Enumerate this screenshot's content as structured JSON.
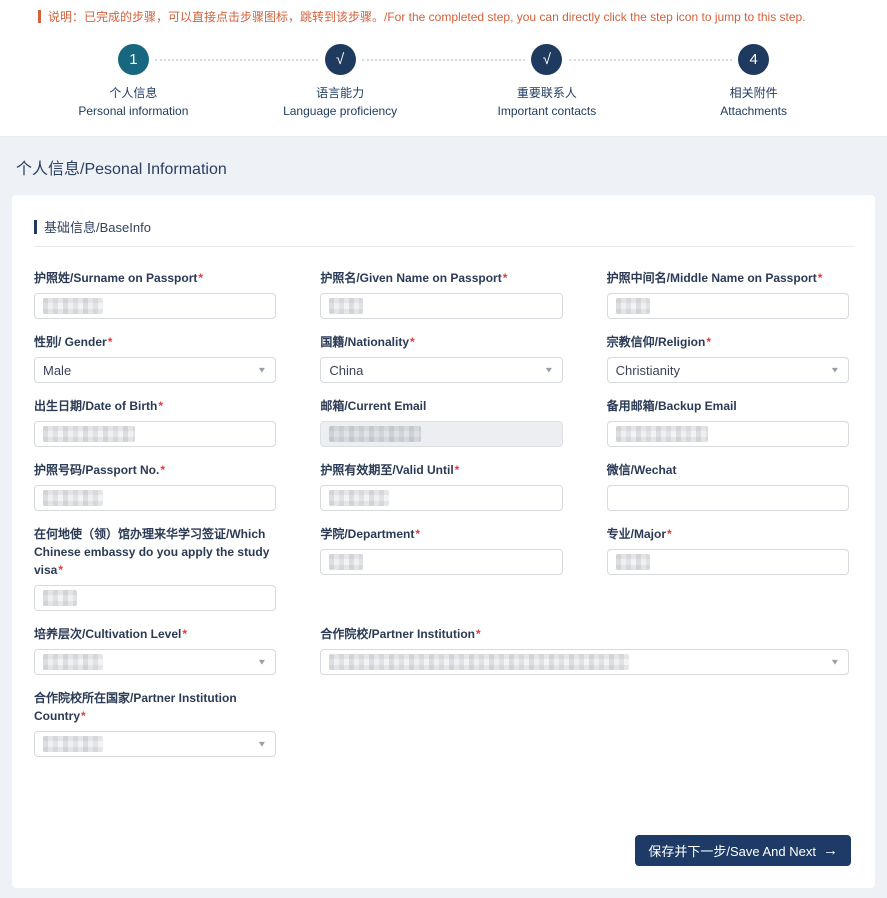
{
  "notice": {
    "text": "说明：已完成的步骤，可以直接点击步骤图标，跳转到该步骤。/For the completed step, you can directly click the step icon to jump to this step."
  },
  "stepper": {
    "steps": [
      {
        "icon": "1",
        "zh": "个人信息",
        "en": "Personal information",
        "state": "active"
      },
      {
        "icon": "√",
        "zh": "语言能力",
        "en": "Language proficiency",
        "state": "done"
      },
      {
        "icon": "√",
        "zh": "重要联系人",
        "en": "Important contacts",
        "state": "done"
      },
      {
        "icon": "4",
        "zh": "相关附件",
        "en": "Attachments",
        "state": "pending"
      }
    ]
  },
  "page": {
    "title": "个人信息/Pesonal Information"
  },
  "card": {
    "section_title": "基础信息/BaseInfo",
    "fields": [
      {
        "label": "护照姓/Surname on Passport",
        "required_mark": "*",
        "type": "text",
        "value_redacted": true
      },
      {
        "label": "护照名/Given Name on Passport",
        "required_mark": "*",
        "type": "text",
        "value_redacted": true
      },
      {
        "label": "护照中间名/Middle Name on Passport",
        "required_mark": "*",
        "type": "text",
        "value_redacted": true
      },
      {
        "label": "性别/ Gender",
        "required_mark": "*",
        "type": "select",
        "value": "Male"
      },
      {
        "label": "国籍/Nationality",
        "required_mark": "*",
        "type": "select",
        "value": "China"
      },
      {
        "label": "宗教信仰/Religion",
        "required_mark": "*",
        "type": "select",
        "value": "Christianity"
      },
      {
        "label": "出生日期/Date of Birth",
        "required_mark": "*",
        "type": "text",
        "value_redacted": true
      },
      {
        "label": "邮箱/Current Email",
        "required_mark": "",
        "type": "text",
        "disabled": true,
        "value_redacted": true
      },
      {
        "label": "备用邮箱/Backup Email",
        "required_mark": "",
        "type": "text",
        "value_redacted": true
      },
      {
        "label": "护照号码/Passport No.",
        "required_mark": "*",
        "type": "text",
        "value_redacted": true
      },
      {
        "label": "护照有效期至/Valid Until",
        "required_mark": "*",
        "type": "text",
        "value_redacted": true
      },
      {
        "label": "微信/Wechat",
        "required_mark": "",
        "type": "text",
        "value": ""
      },
      {
        "label": "在何地使（领）馆办理来华学习签证/Which Chinese embassy do you apply the study visa",
        "required_mark": "*",
        "type": "text",
        "value_redacted": true
      },
      {
        "label": "学院/Department",
        "required_mark": "*",
        "type": "text",
        "value_redacted": true
      },
      {
        "label": "专业/Major",
        "required_mark": "*",
        "type": "text",
        "value_redacted": true
      },
      {
        "label": "培养层次/Cultivation Level",
        "required_mark": "*",
        "type": "select",
        "value_redacted": true
      },
      {
        "label": "合作院校/Partner Institution",
        "required_mark": "*",
        "type": "select",
        "value_redacted": true
      },
      {
        "label": "合作院校所在国家/Partner Institution Country",
        "required_mark": "*",
        "type": "select",
        "value_redacted": true
      }
    ],
    "save_button": {
      "label": "保存并下一步/Save And Next",
      "icon": "→"
    }
  },
  "colors": {
    "accent_navy": "#1e3a5f",
    "step_active_teal": "#16677f",
    "notice_orange": "#d2613c",
    "required_red": "#e23c3c",
    "button_navy": "#1d3b66",
    "page_bg": "#eef1f6"
  }
}
